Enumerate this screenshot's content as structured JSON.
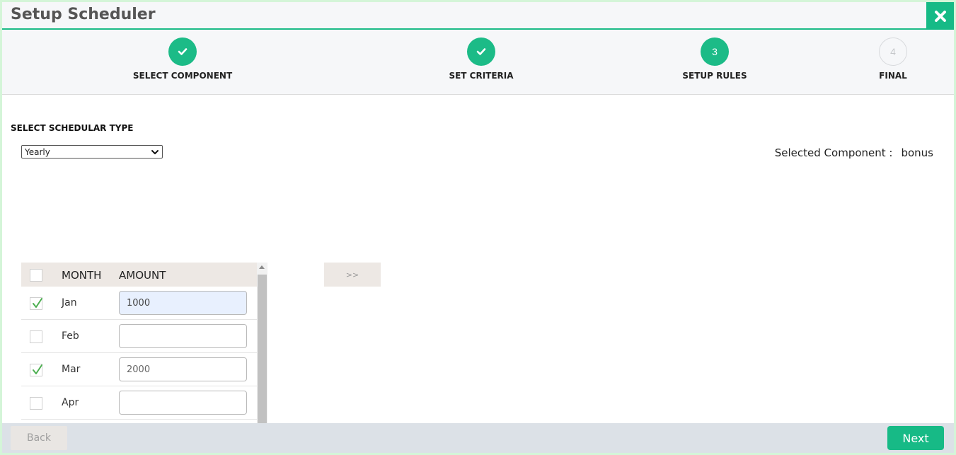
{
  "window": {
    "title": "Setup Scheduler",
    "close_icon": "close-icon",
    "accent": "#1cbb87"
  },
  "stepper": {
    "steps": [
      {
        "label": "SELECT COMPONENT",
        "state": "done",
        "icon": "check-icon"
      },
      {
        "label": "SET CRITERIA",
        "state": "done",
        "icon": "check-icon"
      },
      {
        "label": "SETUP RULES",
        "state": "active",
        "number": "3"
      },
      {
        "label": "FINAL",
        "state": "pending",
        "number": "4"
      }
    ]
  },
  "scheduler": {
    "section_label": "SELECT SCHEDULAR TYPE",
    "type_value": "Yearly",
    "selected_component_label": "Selected Component :",
    "selected_component_value": "bonus"
  },
  "table": {
    "headers": {
      "month": "MONTH",
      "amount": "AMOUNT"
    },
    "rows": [
      {
        "month": "Jan",
        "checked": true,
        "amount": "1000"
      },
      {
        "month": "Feb",
        "checked": false,
        "amount": ""
      },
      {
        "month": "Mar",
        "checked": true,
        "amount": "2000"
      },
      {
        "month": "Apr",
        "checked": false,
        "amount": ""
      }
    ]
  },
  "move_button_label": ">>",
  "footer": {
    "back_label": "Back",
    "next_label": "Next"
  }
}
